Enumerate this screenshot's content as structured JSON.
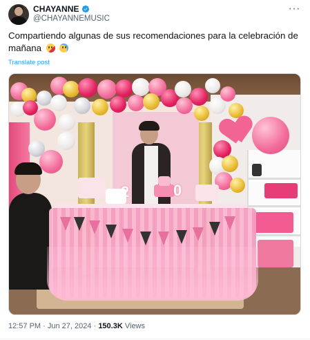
{
  "author": {
    "display_name": "CHAYANNE",
    "handle": "@CHAYANNEMUSIC",
    "verified": true,
    "verified_color": "#1d9bf0"
  },
  "more_menu": {
    "label": "···",
    "icon": "more-horizontal-icon"
  },
  "tweet": {
    "text": "Compartiendo algunas de sus recomendaciones para la celebración de mañana",
    "emojis": [
      "party-face-emoji",
      "grinning-sweat-emoji"
    ],
    "translate_label": "Translate post"
  },
  "media": {
    "type": "photo",
    "alt": "",
    "colors": {
      "tablecloth": "#f59dbf",
      "balloon_pink": "#f26b9a",
      "balloon_gold": "#e8b930"
    }
  },
  "meta": {
    "time": "12:57 PM",
    "separator": "·",
    "date": "Jun 27, 2024",
    "separator2": "·",
    "views_count": "150.3K",
    "views_label": "Views"
  },
  "colors": {
    "text": "#0f1419",
    "secondary": "#536471",
    "link": "#1d9bf0"
  }
}
